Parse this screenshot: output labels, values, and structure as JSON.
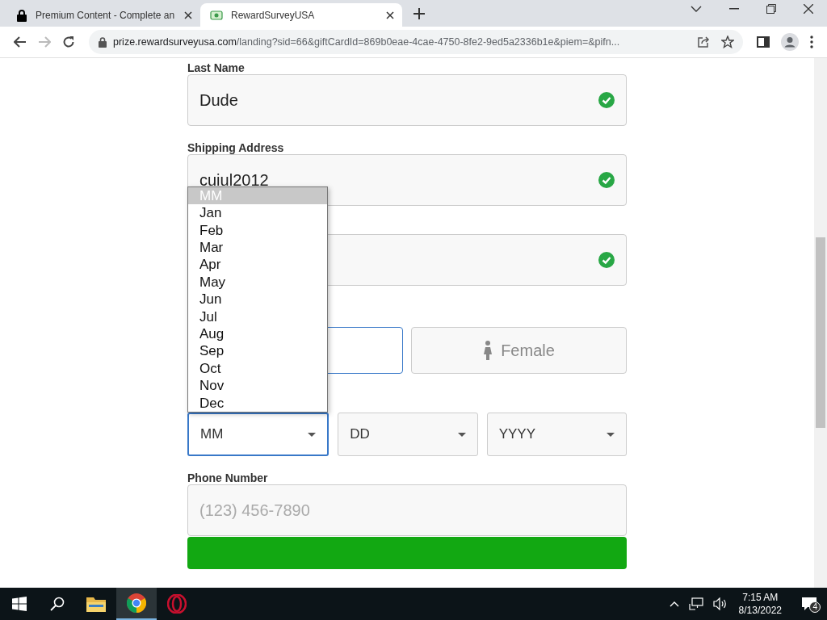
{
  "browser": {
    "tabs": [
      {
        "title": "Premium Content - Complete an",
        "kind": "lock",
        "selected": false
      },
      {
        "title": "RewardSurveyUSA",
        "kind": "gift",
        "selected": true
      }
    ],
    "address": "prize.rewardsurveyusa.com/landing?sid=66&giftCardId=869b0eae-4cae-4750-8fe2-9ed5a2336b1e&piem=&pifn..."
  },
  "form": {
    "fields": [
      {
        "label": "Last Name",
        "value": "Dude",
        "valid": true
      },
      {
        "label": "Shipping Address",
        "value": "cuiul2012",
        "valid": true
      },
      {
        "valid": true
      }
    ],
    "gender_options": [
      {
        "selected": true
      },
      {
        "label": "Female",
        "selected": false
      }
    ],
    "date_selects": [
      {
        "value": "MM",
        "focused": true
      },
      {
        "value": "DD",
        "focused": false
      },
      {
        "value": "YYYY",
        "focused": false
      }
    ],
    "month_dropdown": [
      {
        "label": "MM",
        "selected": true
      },
      {
        "label": "Jan",
        "selected": false
      },
      {
        "label": "Feb",
        "selected": false
      },
      {
        "label": "Mar",
        "selected": false
      },
      {
        "label": "Apr",
        "selected": false
      },
      {
        "label": "May",
        "selected": false
      },
      {
        "label": "Jun",
        "selected": false
      },
      {
        "label": "Jul",
        "selected": false
      },
      {
        "label": "Aug",
        "selected": false
      },
      {
        "label": "Sep",
        "selected": false
      },
      {
        "label": "Oct",
        "selected": false
      },
      {
        "label": "Nov",
        "selected": false
      },
      {
        "label": "Dec",
        "selected": false
      }
    ],
    "phone": {
      "label": "Phone Number",
      "placeholder": "(123) 456-7890"
    }
  },
  "taskbar": {
    "apps": [
      {
        "kind": "folder",
        "active": false
      },
      {
        "kind": "chrome",
        "active": true
      },
      {
        "kind": "opera",
        "active": false
      }
    ],
    "time": "7:15 AM",
    "date": "8/13/2022",
    "notifications": "4"
  }
}
